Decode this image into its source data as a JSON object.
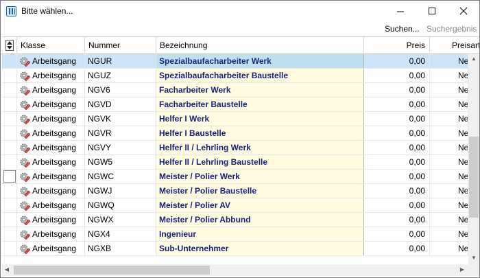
{
  "window": {
    "title": "Bitte wählen..."
  },
  "toolbar": {
    "search_label": "Suchen...",
    "result_label": "Suchergebnis"
  },
  "columns": {
    "klasse": "Klasse",
    "nummer": "Nummer",
    "bezeichnung": "Bezeichnung",
    "preis": "Preis",
    "preisart": "Preisart"
  },
  "row_icon": "gear-eraser-icon",
  "colors": {
    "selected_row": "#cce4f7",
    "bezeichnung_bg": "#fffbe0",
    "bezeichnung_text": "#1a237e"
  },
  "rows": [
    {
      "klasse": "Arbeitsgang",
      "nummer": "NGUR",
      "bezeichnung": "Spezialbaufacharbeiter Werk",
      "preis": "0,00",
      "preisart": "Ne"
    },
    {
      "klasse": "Arbeitsgang",
      "nummer": "NGUZ",
      "bezeichnung": "Spezialbaufacharbeiter Baustelle",
      "preis": "0,00",
      "preisart": "Ne"
    },
    {
      "klasse": "Arbeitsgang",
      "nummer": "NGV6",
      "bezeichnung": "Facharbeiter Werk",
      "preis": "0,00",
      "preisart": "Ne"
    },
    {
      "klasse": "Arbeitsgang",
      "nummer": "NGVD",
      "bezeichnung": "Facharbeiter Baustelle",
      "preis": "0,00",
      "preisart": "Ne"
    },
    {
      "klasse": "Arbeitsgang",
      "nummer": "NGVK",
      "bezeichnung": "Helfer I Werk",
      "preis": "0,00",
      "preisart": "Ne"
    },
    {
      "klasse": "Arbeitsgang",
      "nummer": "NGVR",
      "bezeichnung": "Helfer I Baustelle",
      "preis": "0,00",
      "preisart": "Ne"
    },
    {
      "klasse": "Arbeitsgang",
      "nummer": "NGVY",
      "bezeichnung": "Helfer II / Lehrling Werk",
      "preis": "0,00",
      "preisart": "Ne"
    },
    {
      "klasse": "Arbeitsgang",
      "nummer": "NGW5",
      "bezeichnung": "Helfer II / Lehrling Baustelle",
      "preis": "0,00",
      "preisart": "Ne"
    },
    {
      "klasse": "Arbeitsgang",
      "nummer": "NGWC",
      "bezeichnung": "Meister / Polier Werk",
      "preis": "0,00",
      "preisart": "Ne"
    },
    {
      "klasse": "Arbeitsgang",
      "nummer": "NGWJ",
      "bezeichnung": "Meister / Polier Baustelle",
      "preis": "0,00",
      "preisart": "Ne"
    },
    {
      "klasse": "Arbeitsgang",
      "nummer": "NGWQ",
      "bezeichnung": "Meister / Polier AV",
      "preis": "0,00",
      "preisart": "Ne"
    },
    {
      "klasse": "Arbeitsgang",
      "nummer": "NGWX",
      "bezeichnung": "Meister / Polier Abbund",
      "preis": "0,00",
      "preisart": "Ne"
    },
    {
      "klasse": "Arbeitsgang",
      "nummer": "NGX4",
      "bezeichnung": "Ingenieur",
      "preis": "0,00",
      "preisart": "Ne"
    },
    {
      "klasse": "Arbeitsgang",
      "nummer": "NGXB",
      "bezeichnung": "Sub-Unternehmer",
      "preis": "0,00",
      "preisart": "Ne"
    }
  ]
}
